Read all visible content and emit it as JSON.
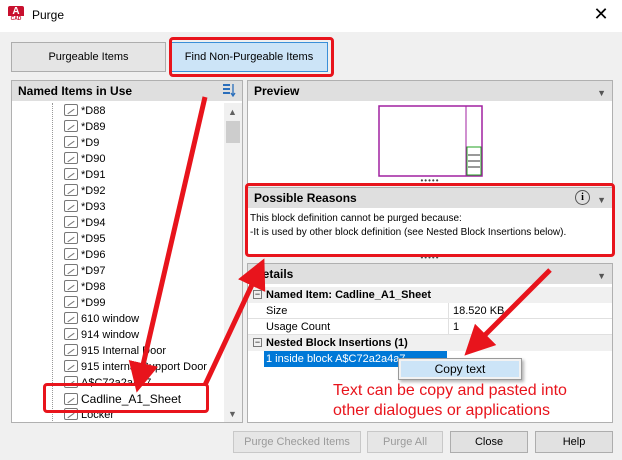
{
  "window": {
    "title": "Purge",
    "app_icon_letter": "A",
    "app_icon_sub": "CAD",
    "close_glyph": "✕"
  },
  "tabs": [
    {
      "label": "Purgeable Items"
    },
    {
      "label": "Find Non-Purgeable Items"
    }
  ],
  "named_items": {
    "header": "Named Items in Use",
    "items": [
      "*D88",
      "*D89",
      "*D9",
      "*D90",
      "*D91",
      "*D92",
      "*D93",
      "*D94",
      "*D95",
      "*D96",
      "*D97",
      "*D98",
      "*D99",
      "610 window",
      "914 window",
      "915 Internal Door",
      "915 internal Support Door",
      "A$C72a2a4a7",
      "Cadline_A1_Sheet",
      "Locker"
    ]
  },
  "preview": {
    "header": "Preview"
  },
  "possible_reasons": {
    "header": "Possible Reasons",
    "line1": "This block definition cannot be purged because:",
    "line2": "-It is used by other block definition (see Nested Block Insertions below)."
  },
  "details": {
    "header": "Details",
    "group1_title": "Named Item: Cadline_A1_Sheet",
    "rows": [
      {
        "label": "Size",
        "value": "18.520 KB"
      },
      {
        "label": "Usage Count",
        "value": "1"
      }
    ],
    "group2_title": "Nested Block Insertions (1)",
    "nested_row": "1 inside block A$C72a2a4a7"
  },
  "context_menu": {
    "item": "Copy text"
  },
  "buttons": {
    "purge_checked": "Purge Checked Items",
    "purge_all": "Purge All",
    "close": "Close",
    "help": "Help"
  },
  "annotation": {
    "line1": "Text can be copy and pasted into",
    "line2": "other dialogues or applications"
  },
  "colors": {
    "accent": "#e8141c",
    "selection": "#0078d7",
    "tab_active": "#cce4f7"
  }
}
